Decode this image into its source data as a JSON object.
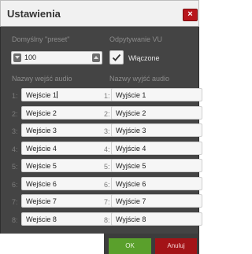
{
  "dialog": {
    "title": "Ustawienia",
    "close_label": "×"
  },
  "preset": {
    "label": "Domyślny \"preset\"",
    "value": "100"
  },
  "vu": {
    "label": "Odpytywanie VU",
    "checkbox_label": "Włączone",
    "checked": true
  },
  "inputs": {
    "header": "Nazwy wejść audio",
    "items": [
      {
        "num": "1:",
        "value": "Wejście 1"
      },
      {
        "num": "2:",
        "value": "Wejście 2"
      },
      {
        "num": "3:",
        "value": "Wejście 3"
      },
      {
        "num": "4:",
        "value": "Wejście 4"
      },
      {
        "num": "5:",
        "value": "Wejście 5"
      },
      {
        "num": "6:",
        "value": "Wejście 6"
      },
      {
        "num": "7:",
        "value": "Wejście 7"
      },
      {
        "num": "8:",
        "value": "Wejście 8"
      }
    ]
  },
  "outputs": {
    "header": "Nazwy wyjść audio",
    "items": [
      {
        "num": "1:",
        "value": "Wyjście 1"
      },
      {
        "num": "2:",
        "value": "Wyjście 2"
      },
      {
        "num": "3:",
        "value": "Wyjście 3"
      },
      {
        "num": "4:",
        "value": "Wyjście 4"
      },
      {
        "num": "5:",
        "value": "Wyjście 5"
      },
      {
        "num": "6:",
        "value": "Wyjście 6"
      },
      {
        "num": "7:",
        "value": "Wyjście 7"
      },
      {
        "num": "8:",
        "value": "Wyjście 8"
      }
    ]
  },
  "footer": {
    "ok_label": "OK",
    "cancel_label": "Anuluj"
  },
  "colors": {
    "panel": "#444444",
    "ok": "#5aa02c",
    "cancel": "#a31317",
    "close": "#b8161c"
  }
}
